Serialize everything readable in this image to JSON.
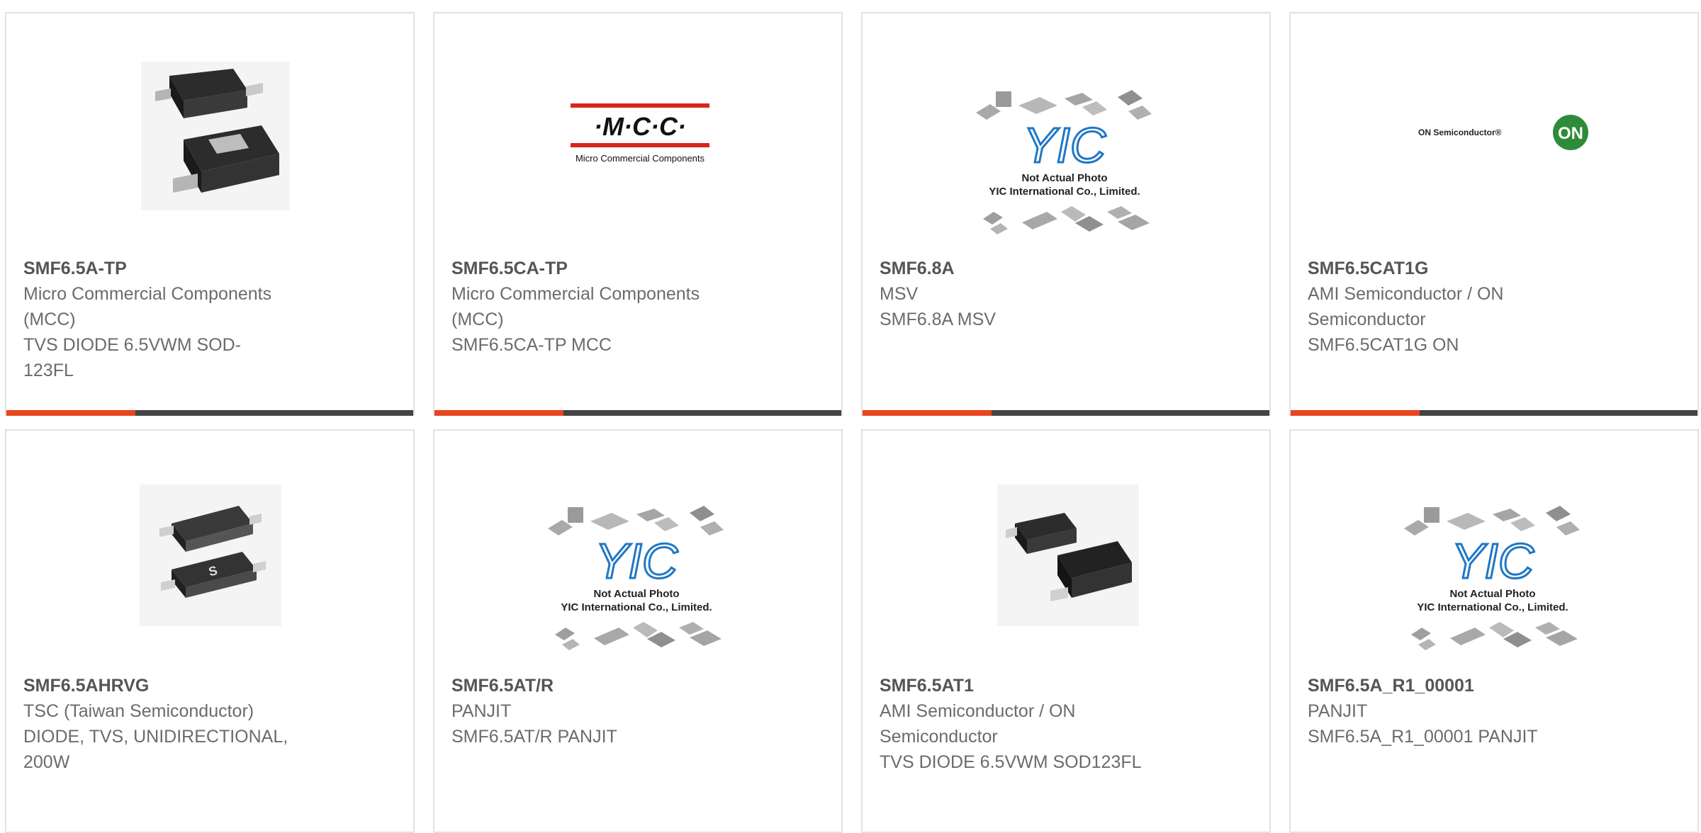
{
  "products": [
    {
      "part_number": "SMF6.5A-TP",
      "manufacturer": "Micro Commercial Components (MCC)",
      "manufacturer_lines": [
        "Micro Commercial Components",
        "(MCC)"
      ],
      "description_lines": [
        "TVS DIODE 6.5VWM SOD-",
        "123FL"
      ],
      "image": "sod123fl-package-photo"
    },
    {
      "part_number": "SMF6.5CA-TP",
      "manufacturer_lines": [
        "Micro Commercial Components",
        "(MCC)"
      ],
      "description_lines": [
        "SMF6.5CA-TP MCC"
      ],
      "image": "mcc-logo",
      "logo_text": "·M·C·C·",
      "logo_sub": "Micro Commercial Components"
    },
    {
      "part_number": "SMF6.8A",
      "manufacturer_lines": [
        "MSV"
      ],
      "description_lines": [
        "SMF6.8A MSV"
      ],
      "image": "yic-placeholder",
      "placeholder_logo": "YIC",
      "placeholder_line1": "Not Actual Photo",
      "placeholder_line2": "YIC International Co., Limited."
    },
    {
      "part_number": "SMF6.5CAT1G",
      "manufacturer_lines": [
        "AMI Semiconductor / ON",
        "Semiconductor"
      ],
      "description_lines": [
        "SMF6.5CAT1G ON"
      ],
      "image": "on-semiconductor-logo",
      "logo_text": "ON Semiconductor®",
      "logo_badge": "ON"
    },
    {
      "part_number": "SMF6.5AHRVG",
      "manufacturer_lines": [
        "TSC (Taiwan Semiconductor)"
      ],
      "description_lines": [
        "DIODE, TVS, UNIDIRECTIONAL,",
        "200W"
      ],
      "image": "tsc-package-photo"
    },
    {
      "part_number": "SMF6.5AT/R",
      "manufacturer_lines": [
        "PANJIT"
      ],
      "description_lines": [
        "SMF6.5AT/R PANJIT"
      ],
      "image": "yic-placeholder",
      "placeholder_logo": "YIC",
      "placeholder_line1": "Not Actual Photo",
      "placeholder_line2": "YIC International Co., Limited."
    },
    {
      "part_number": "SMF6.5AT1",
      "manufacturer_lines": [
        "AMI Semiconductor / ON",
        "Semiconductor"
      ],
      "description_lines": [
        "TVS DIODE 6.5VWM SOD123FL"
      ],
      "image": "sod123fl-package-photo"
    },
    {
      "part_number": "SMF6.5A_R1_00001",
      "manufacturer_lines": [
        "PANJIT"
      ],
      "description_lines": [
        "SMF6.5A_R1_00001 PANJIT"
      ],
      "image": "yic-placeholder",
      "placeholder_logo": "YIC",
      "placeholder_line1": "Not Actual Photo",
      "placeholder_line2": "YIC International Co., Limited."
    }
  ],
  "colors": {
    "accent": "#e8441e",
    "bar": "#444444",
    "title": "#555555",
    "text": "#6b6b6b",
    "border": "#e2e2e2"
  }
}
